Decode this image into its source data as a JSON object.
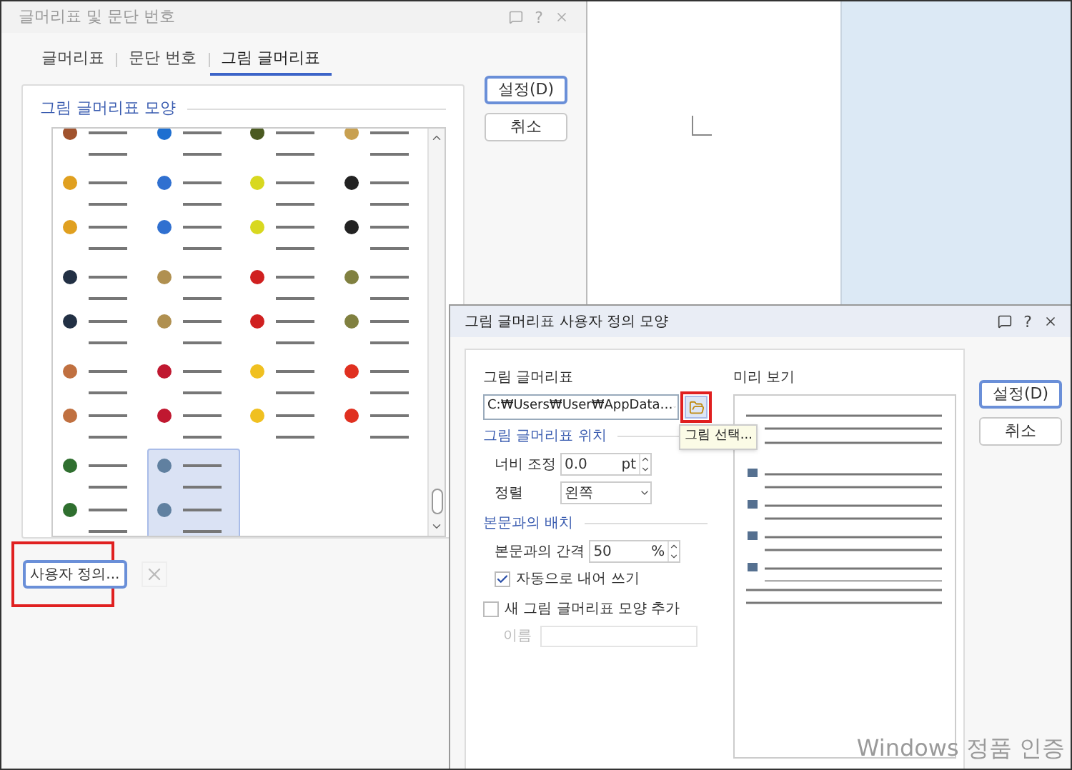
{
  "main_dialog": {
    "title": "글머리표 및 문단 번호",
    "help": "?",
    "tabs": [
      {
        "label": "글머리표",
        "selected": false
      },
      {
        "label": "문단 번호",
        "selected": false
      },
      {
        "label": "그림 글머리표",
        "selected": true
      }
    ],
    "group_label": "그림 글머리표 모양",
    "bullets": [
      {
        "color": "#a0522d",
        "selected": false
      },
      {
        "color": "#1e6fd0",
        "selected": false
      },
      {
        "color": "#4a5a20",
        "selected": false
      },
      {
        "color": "#c8a050",
        "selected": false
      },
      {
        "color": "#e0a020",
        "selected": false
      },
      {
        "color": "#3070d0",
        "selected": false
      },
      {
        "color": "#d8d820",
        "selected": false
      },
      {
        "color": "#222222",
        "selected": false
      },
      {
        "color": "#223044",
        "selected": false
      },
      {
        "color": "#b09050",
        "selected": false
      },
      {
        "color": "#d02020",
        "selected": false
      },
      {
        "color": "#808040",
        "selected": false
      },
      {
        "color": "#c07040",
        "selected": false
      },
      {
        "color": "#c01830",
        "selected": false
      },
      {
        "color": "#f0c020",
        "selected": false
      },
      {
        "color": "#e03020",
        "selected": false
      },
      {
        "color": "#2f6f2f",
        "selected": false
      },
      {
        "color": "#6080a0",
        "selected": true
      }
    ],
    "buttons": [
      {
        "label": "설정(D)",
        "primary": true
      },
      {
        "label": "취소",
        "primary": false
      }
    ],
    "custom_button": "사용자 정의..."
  },
  "custom_dialog": {
    "title": "그림 글머리표 사용자 정의 모양",
    "help": "?",
    "image_label": "그림 글머리표",
    "path_value": "C:₩Users₩User₩AppData…",
    "tooltip": "그림 선택...",
    "position_label": "그림 글머리표 위치",
    "width_label": "너비 조정",
    "width_value": "0.0",
    "width_unit": "pt",
    "align_label": "정렬",
    "align_value": "왼쪽",
    "layout_label": "본문과의 배치",
    "gap_label": "본문과의 간격",
    "gap_value": "50",
    "gap_unit": "%",
    "auto_indent": {
      "label": "자동으로 내어 쓰기",
      "checked": true
    },
    "add_new": {
      "label": "새 그림 글머리표 모양 추가",
      "checked": false
    },
    "name_label": "이름",
    "preview_label": "미리 보기",
    "buttons": [
      {
        "label": "설정(D)",
        "primary": true
      },
      {
        "label": "취소",
        "primary": false
      }
    ]
  },
  "watermark": "Windows 정품 인증"
}
